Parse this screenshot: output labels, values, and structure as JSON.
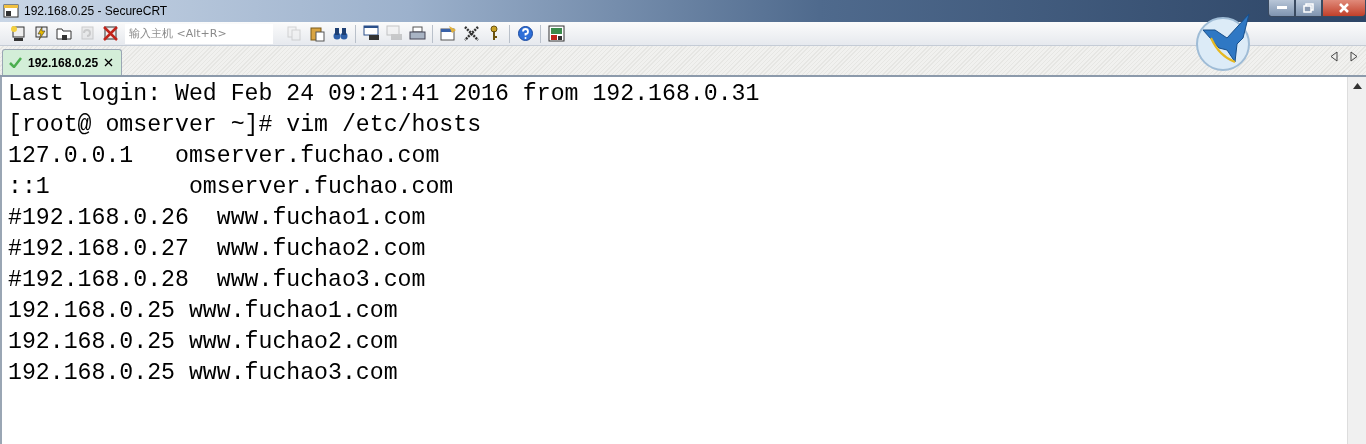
{
  "window": {
    "title": "192.168.0.25 - SecureCRT"
  },
  "toolbar": {
    "buttons": [
      {
        "kind": "connect",
        "disabled": false
      },
      {
        "kind": "quick",
        "disabled": false
      },
      {
        "kind": "folder",
        "disabled": false
      },
      {
        "kind": "reconnect",
        "disabled": true
      },
      {
        "kind": "disconnect",
        "disabled": false
      },
      {
        "kind": "host-field",
        "placeholder": "输入主机 <Alt+R>"
      },
      {
        "kind": "copy",
        "disabled": true
      },
      {
        "kind": "paste",
        "disabled": false
      },
      {
        "kind": "find",
        "disabled": false
      },
      {
        "kind": "sep"
      },
      {
        "kind": "page-setup",
        "disabled": false
      },
      {
        "kind": "print-selection",
        "disabled": true
      },
      {
        "kind": "print",
        "disabled": false
      },
      {
        "kind": "sep"
      },
      {
        "kind": "options",
        "disabled": false
      },
      {
        "kind": "tool",
        "disabled": false
      },
      {
        "kind": "key",
        "disabled": false
      },
      {
        "kind": "sep"
      },
      {
        "kind": "help",
        "disabled": false
      },
      {
        "kind": "sep"
      },
      {
        "kind": "keymap",
        "disabled": false
      }
    ]
  },
  "tabs": [
    {
      "label": "192.168.0.25",
      "selected": true,
      "connected": true
    }
  ],
  "terminal": {
    "lines": [
      "Last login: Wed Feb 24 09:21:41 2016 from 192.168.0.31",
      "[root@ omserver ~]# vim /etc/hosts",
      "127.0.0.1   omserver.fuchao.com",
      "::1          omserver.fuchao.com",
      "#192.168.0.26  www.fuchao1.com",
      "#192.168.0.27  www.fuchao2.com",
      "#192.168.0.28  www.fuchao3.com",
      "192.168.0.25 www.fuchao1.com",
      "192.168.0.25 www.fuchao2.com",
      "192.168.0.25 www.fuchao3.com"
    ]
  }
}
